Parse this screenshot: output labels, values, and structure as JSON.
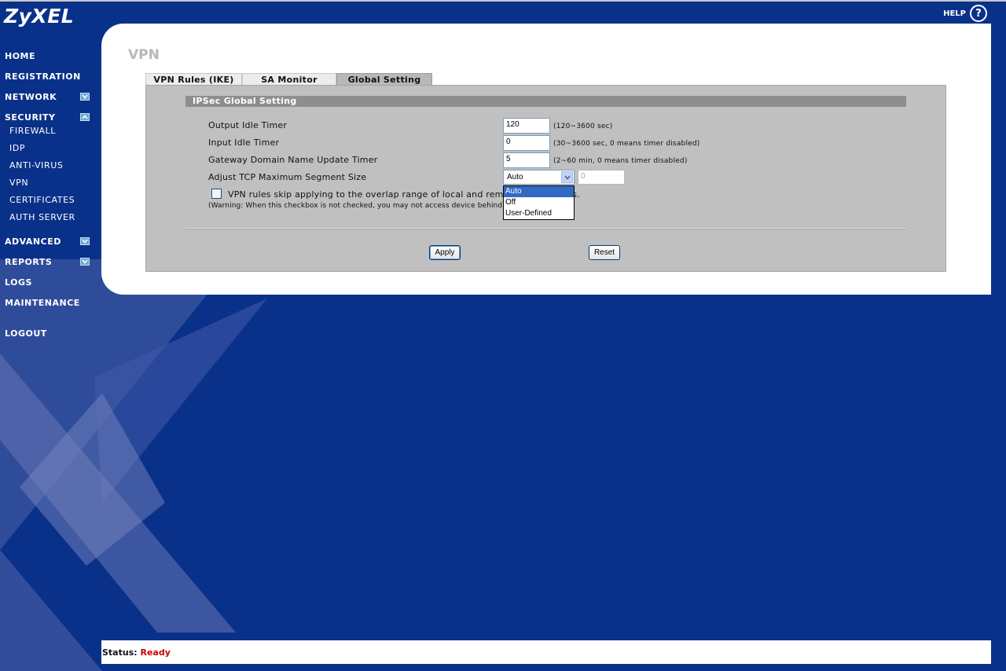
{
  "brand": {
    "logo": "ZyXEL",
    "help_label": "HELP",
    "help_icon": "?"
  },
  "nav": {
    "home": "HOME",
    "registration": "REGISTRATION",
    "network": "NETWORK",
    "security": "SECURITY",
    "security_items": [
      "FIREWALL",
      "IDP",
      "ANTI-VIRUS",
      "VPN",
      "CERTIFICATES",
      "AUTH SERVER"
    ],
    "advanced": "ADVANCED",
    "reports": "REPORTS",
    "logs": "LOGS",
    "maintenance": "MAINTENANCE",
    "logout": "LOGOUT"
  },
  "page": {
    "title": "VPN",
    "tabs": [
      {
        "label": "VPN Rules (IKE)",
        "active": false
      },
      {
        "label": "SA Monitor",
        "active": false
      },
      {
        "label": "Global Setting",
        "active": true
      }
    ]
  },
  "form": {
    "section_title": "IPSec Global Setting",
    "output_idle": {
      "label": "Output Idle Timer",
      "value": "120",
      "hint": "(120~3600 sec)"
    },
    "input_idle": {
      "label": "Input Idle Timer",
      "value": "0",
      "hint": "(30~3600 sec, 0 means timer disabled)"
    },
    "gateway_dns": {
      "label": "Gateway Domain Name Update Timer",
      "value": "5",
      "hint": "(2~60 min, 0 means timer disabled)"
    },
    "tcp_mss": {
      "label": "Adjust TCP Maximum Segment Size",
      "selected": "Auto",
      "options": [
        "Auto",
        "Off",
        "User-Defined"
      ],
      "value_field": "0"
    },
    "skip_overlap": {
      "label": "VPN rules skip applying to the overlap range of local and remote IP addresses.",
      "checked": false
    },
    "warning": "(Warning: When this checkbox is not checked, you may not access device behind using VPN tunnels)",
    "apply_label": "Apply",
    "reset_label": "Reset"
  },
  "status": {
    "label": "Status:",
    "value": "Ready"
  }
}
